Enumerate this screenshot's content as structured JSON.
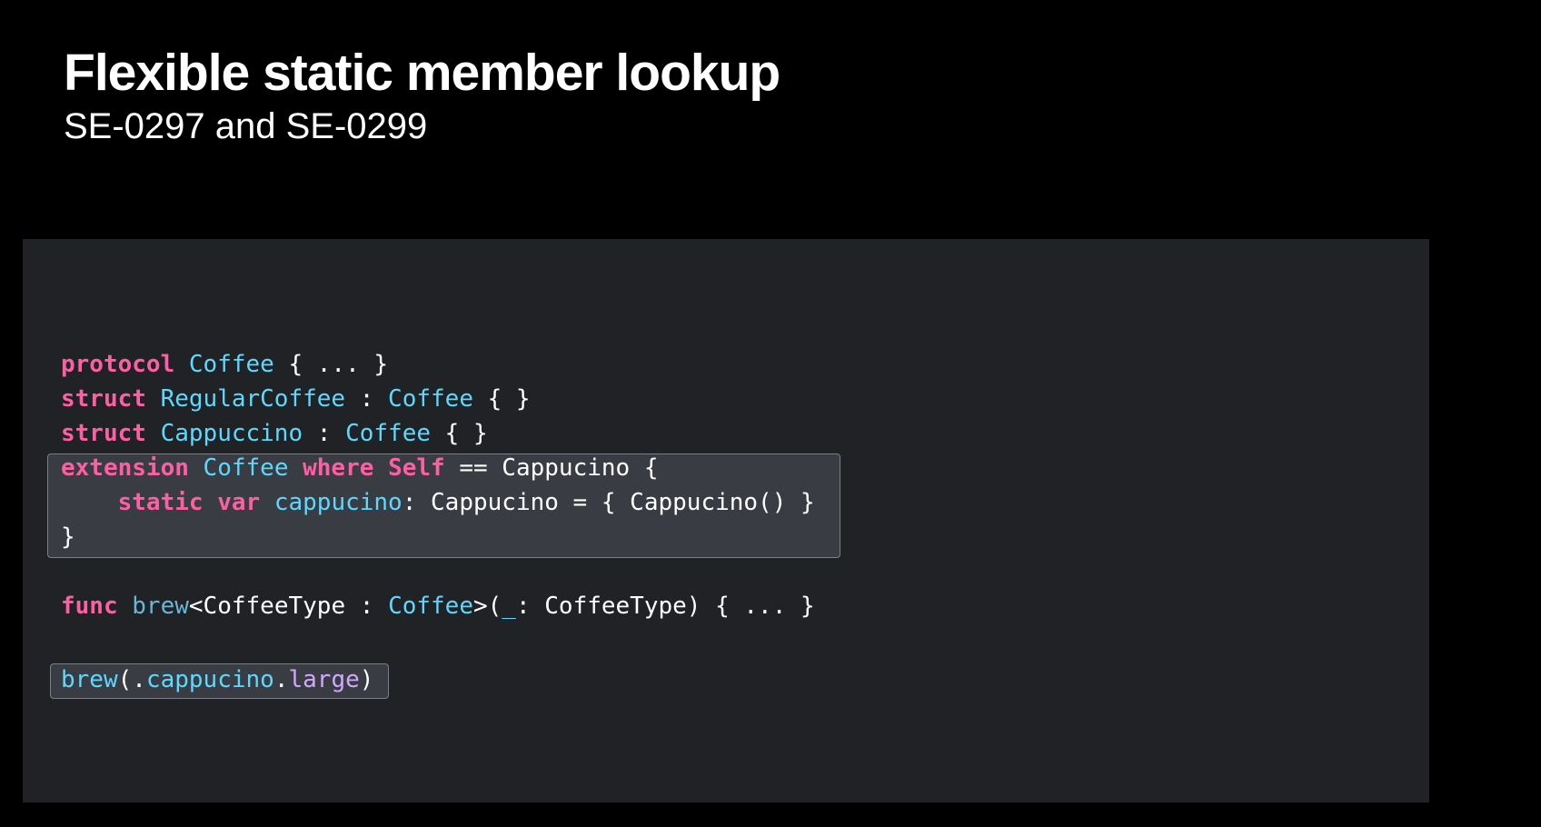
{
  "slide": {
    "title": "Flexible static member lookup",
    "subtitle": "SE-0297 and SE-0299"
  },
  "code": {
    "line1": [
      {
        "t": "protocol",
        "c": "kw"
      },
      {
        "t": " ",
        "c": "plain"
      },
      {
        "t": "Coffee",
        "c": "type"
      },
      {
        "t": " { ... }",
        "c": "plain"
      }
    ],
    "line2": [
      {
        "t": "struct",
        "c": "kw"
      },
      {
        "t": " ",
        "c": "plain"
      },
      {
        "t": "RegularCoffee",
        "c": "type"
      },
      {
        "t": " : ",
        "c": "plain"
      },
      {
        "t": "Coffee",
        "c": "type"
      },
      {
        "t": " { }",
        "c": "plain"
      }
    ],
    "line3": [
      {
        "t": "struct",
        "c": "kw"
      },
      {
        "t": " ",
        "c": "plain"
      },
      {
        "t": "Cappuccino",
        "c": "type"
      },
      {
        "t": " : ",
        "c": "plain"
      },
      {
        "t": "Coffee",
        "c": "type"
      },
      {
        "t": " { }",
        "c": "plain"
      }
    ],
    "line4": [
      {
        "t": "extension",
        "c": "kw"
      },
      {
        "t": " ",
        "c": "plain"
      },
      {
        "t": "Coffee",
        "c": "type"
      },
      {
        "t": " ",
        "c": "plain"
      },
      {
        "t": "where",
        "c": "kw"
      },
      {
        "t": " ",
        "c": "plain"
      },
      {
        "t": "Self",
        "c": "kw"
      },
      {
        "t": " == Cappucino {",
        "c": "plain"
      }
    ],
    "line5": [
      {
        "t": "    ",
        "c": "plain"
      },
      {
        "t": "static",
        "c": "kw"
      },
      {
        "t": " ",
        "c": "plain"
      },
      {
        "t": "var",
        "c": "kw"
      },
      {
        "t": " ",
        "c": "plain"
      },
      {
        "t": "cappucino",
        "c": "type"
      },
      {
        "t": ": Cappucino = { Cappucino() }",
        "c": "plain"
      }
    ],
    "line6": [
      {
        "t": "}",
        "c": "plain"
      }
    ],
    "line7": [
      {
        "t": "func",
        "c": "kw"
      },
      {
        "t": " ",
        "c": "plain"
      },
      {
        "t": "brew",
        "c": "fn"
      },
      {
        "t": "<CoffeeType : ",
        "c": "plain"
      },
      {
        "t": "Coffee",
        "c": "type"
      },
      {
        "t": ">(",
        "c": "plain"
      },
      {
        "t": "_",
        "c": "type"
      },
      {
        "t": ": CoffeeType) { ... }",
        "c": "plain"
      }
    ],
    "line8": [
      {
        "t": "brew",
        "c": "type"
      },
      {
        "t": "(.",
        "c": "plain"
      },
      {
        "t": "cappucino",
        "c": "type"
      },
      {
        "t": ".",
        "c": "plain"
      },
      {
        "t": "large",
        "c": "prop"
      },
      {
        "t": ")",
        "c": "plain"
      }
    ]
  },
  "colors": {
    "background": "#000000",
    "panel": "#212225",
    "highlight": "#3a3c43",
    "keyword": "#fc5fa3",
    "type": "#5dd8ff",
    "function": "#67b7d9",
    "property": "#d0a8ff",
    "text": "#ffffff"
  }
}
